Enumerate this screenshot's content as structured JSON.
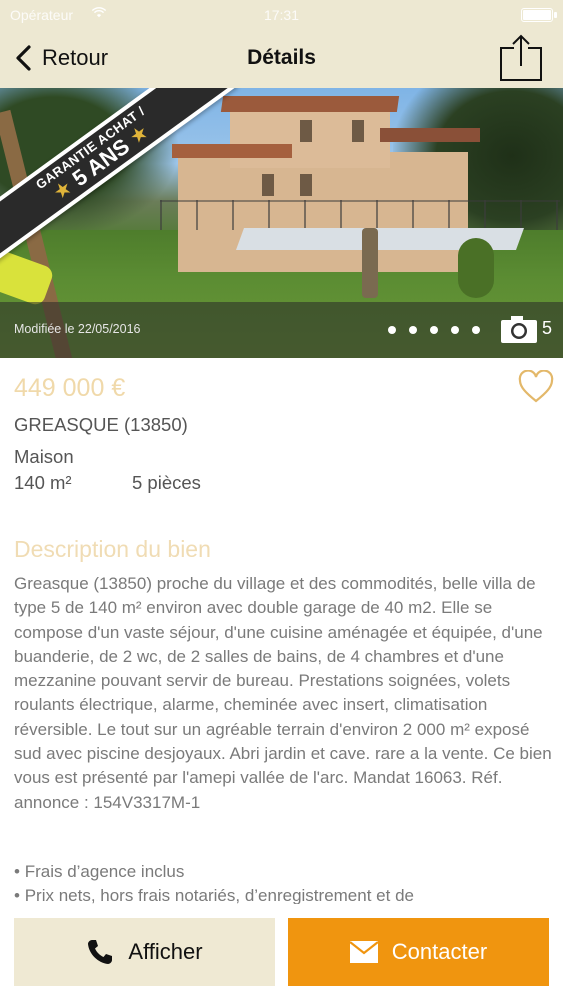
{
  "status_bar": {
    "carrier": "Opérateur",
    "time": "17:31",
    "icons": [
      "wifi-icon",
      "battery-icon"
    ]
  },
  "nav": {
    "back_label": "Retour",
    "title": "Détails",
    "share_icon": "share-icon"
  },
  "photo": {
    "badge_line1": "GARANTIE ACHAT /",
    "badge_line2": "5 ANS",
    "modified": "Modifiée le 22/05/2016",
    "photo_count": "5",
    "pages_total": 5,
    "current_page": 1
  },
  "listing": {
    "price": "449 000 €",
    "city": "GREASQUE (13850)",
    "property_type": "Maison",
    "surface": "140 m²",
    "rooms": "5 pièces"
  },
  "description": {
    "title": "Description du bien",
    "text": "Greasque (13850) proche du village et des commodités, belle villa de type 5 de 140 m² environ avec double garage de 40 m2. Elle se compose d'un vaste séjour, d'une cuisine aménagée et équipée, d'une buanderie, de 2 wc, de 2 salles de bains, de 4 chambres et d'une mezzanine pouvant servir de bureau. Prestations soignées, volets roulants électrique, alarme, cheminée avec insert, climatisation réversible. Le tout sur un agréable terrain d'environ 2 000 m² exposé sud avec piscine desjoyaux. Abri jardin et cave. rare a la vente. Ce bien vous est présenté par l'amepi vallée de l'arc. Mandat 16063. Réf. annonce : 154V3317M-1",
    "bullets": [
      "Frais d’agence inclus",
      "Prix nets, hors frais notariés, d’enregistrement et de"
    ]
  },
  "actions": {
    "call_label": "Afficher",
    "contact_label": "Contacter"
  },
  "colors": {
    "header_bg": "#ede8d2",
    "accent_orange": "#f0950f",
    "price_color": "#f0d9aa",
    "heart_color": "#e3b86a"
  }
}
